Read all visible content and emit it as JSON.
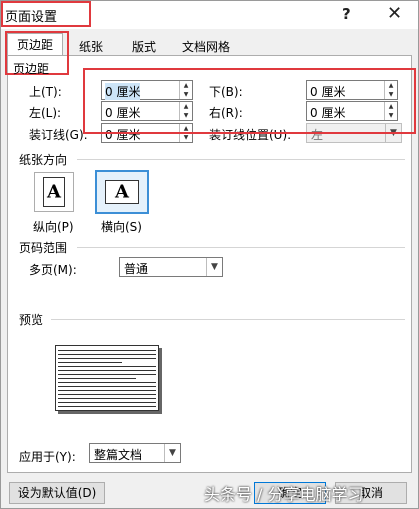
{
  "window": {
    "title": "页面设置",
    "help_label": "?",
    "close_label": "✕"
  },
  "tabs": [
    {
      "label": "页边距",
      "active": true
    },
    {
      "label": "纸张",
      "active": false
    },
    {
      "label": "版式",
      "active": false
    },
    {
      "label": "文档网格",
      "active": false
    }
  ],
  "margins": {
    "section_title": "页边距",
    "top_label": "上(T):",
    "top_value": "0 厘米",
    "bottom_label": "下(B):",
    "bottom_value": "0 厘米",
    "left_label": "左(L):",
    "left_value": "0 厘米",
    "right_label": "右(R):",
    "right_value": "0 厘米",
    "gutter_label": "装订线(G):",
    "gutter_value": "0 厘米",
    "gutter_pos_label": "装订线位置(U):",
    "gutter_pos_value": "左"
  },
  "orientation": {
    "section_title": "纸张方向",
    "glyph": "A",
    "portrait_label": "纵向(P)",
    "landscape_label": "横向(S)",
    "selected": "landscape"
  },
  "pages": {
    "section_title": "页码范围",
    "multiple_label": "多页(M):",
    "multiple_value": "普通"
  },
  "preview": {
    "section_title": "预览"
  },
  "apply": {
    "label": "应用于(Y):",
    "value": "整篇文档"
  },
  "buttons": {
    "set_default": "设为默认值(D)",
    "ok": "确定",
    "cancel": "取消"
  },
  "watermark": "头条号 / 分享电脑学习",
  "colors": {
    "highlight_box": "#e0393e",
    "selected_border": "#3c8fd6"
  }
}
